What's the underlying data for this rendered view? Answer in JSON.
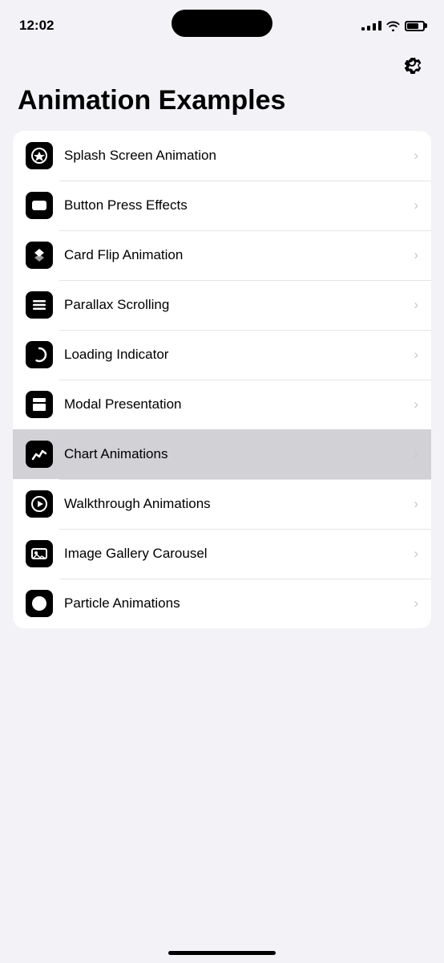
{
  "statusBar": {
    "time": "12:02"
  },
  "header": {
    "title": "Animation Examples"
  },
  "settings": {
    "label": "Settings"
  },
  "listItems": [
    {
      "id": "splash",
      "label": "Splash Screen Animation",
      "icon": "star"
    },
    {
      "id": "button",
      "label": "Button Press Effects",
      "icon": "button"
    },
    {
      "id": "cardflip",
      "label": "Card Flip Animation",
      "icon": "cube"
    },
    {
      "id": "parallax",
      "label": "Parallax Scrolling",
      "icon": "lines"
    },
    {
      "id": "loading",
      "label": "Loading Indicator",
      "icon": "refresh"
    },
    {
      "id": "modal",
      "label": "Modal Presentation",
      "icon": "stack"
    },
    {
      "id": "chart",
      "label": "Chart Animations",
      "icon": "chart",
      "highlighted": true
    },
    {
      "id": "walkthrough",
      "label": "Walkthrough Animations",
      "icon": "arrow"
    },
    {
      "id": "gallery",
      "label": "Image Gallery Carousel",
      "icon": "image"
    },
    {
      "id": "particle",
      "label": "Particle Animations",
      "icon": "circle"
    }
  ],
  "chevronChar": "›",
  "homeIndicator": {}
}
